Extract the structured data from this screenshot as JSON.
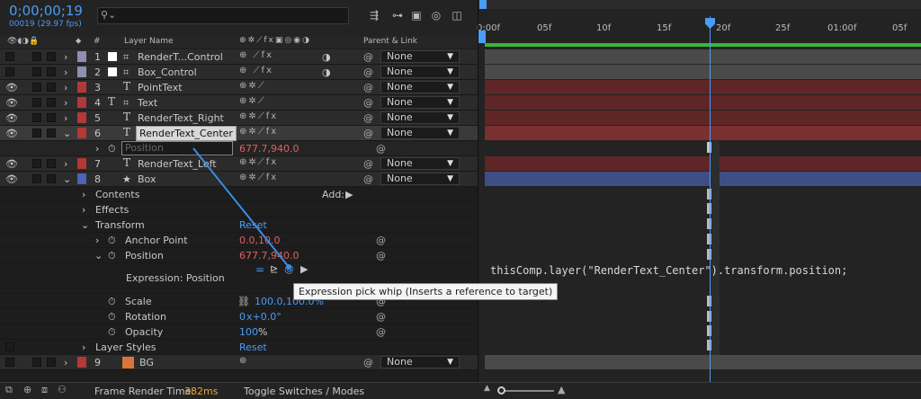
{
  "timecode": "0;00;00;19",
  "fps": "00019 (29.97 fps)",
  "search": {
    "placeholder": ""
  },
  "columns": {
    "num": "#",
    "layer_name": "Layer Name",
    "parent_link": "Parent & Link"
  },
  "layers": [
    {
      "num": "1",
      "name": "RenderT...Control",
      "type_icon": "comp-icon",
      "color": "#8f8fb4",
      "parent": "None"
    },
    {
      "num": "2",
      "name": "Box_Control",
      "type_icon": "comp-icon",
      "color": "#8f8fb4",
      "parent": "None"
    },
    {
      "num": "3",
      "name": "PointText",
      "type_icon": "text-icon",
      "color": "#b33838",
      "parent": "None"
    },
    {
      "num": "4",
      "name": "Text",
      "type_icon": "text-icon",
      "color": "#b33838",
      "parent": "None"
    },
    {
      "num": "5",
      "name": "RenderText_Right",
      "type_icon": "text-icon",
      "color": "#b33838",
      "parent": "None"
    },
    {
      "num": "6",
      "name": "RenderText_Center",
      "type_icon": "text-icon",
      "color": "#b33838",
      "parent": "None"
    },
    {
      "num": "7",
      "name": "RenderText_Left",
      "type_icon": "text-icon",
      "color": "#b33838",
      "parent": "None"
    },
    {
      "num": "8",
      "name": "Box",
      "type_icon": "shape-icon",
      "color": "#4d62b8",
      "parent": "None"
    },
    {
      "num": "9",
      "name": "BG",
      "type_icon": "image-icon",
      "color": "#b33838",
      "parent": "None"
    }
  ],
  "position_row": {
    "label": "Position",
    "value": "677.7,940.0"
  },
  "groups": {
    "contents": "Contents",
    "add": "Add:",
    "effects": "Effects",
    "transform": "Transform",
    "reset": "Reset",
    "layer_styles": "Layer Styles"
  },
  "transform": {
    "anchor_label": "Anchor Point",
    "anchor_value": "0.0,10.0",
    "position_label": "Position",
    "position_value": "677.7,940.0",
    "expression_label": "Expression: Position",
    "scale_label": "Scale",
    "scale_value": "100.0,100.0%",
    "rotation_label": "Rotation",
    "rotation_value_a": "0",
    "rotation_value_b": "x+0.0°",
    "opacity_label": "Opacity",
    "opacity_value": "100",
    "opacity_unit": "%"
  },
  "timeline": {
    "labels": [
      "0:00f",
      "05f",
      "10f",
      "15f",
      "20f",
      "25f",
      "01:00f",
      "05f"
    ],
    "expression_text": "thisComp.layer(\"RenderText_Center\").transform.position;"
  },
  "tooltip": "Expression pick whip (Inserts a reference to target)",
  "bottom": {
    "render_label": "Frame Render Time:",
    "render_value": "382ms",
    "toggle": "Toggle Switches / Modes"
  },
  "colors": {
    "accent": "#4b9cf5",
    "value_red": "#e06060",
    "bar_gray": "#4a4a4a",
    "bar_red": "#6d2a2a",
    "bar_blue": "#3f4f86",
    "work_area": "#38b838"
  }
}
